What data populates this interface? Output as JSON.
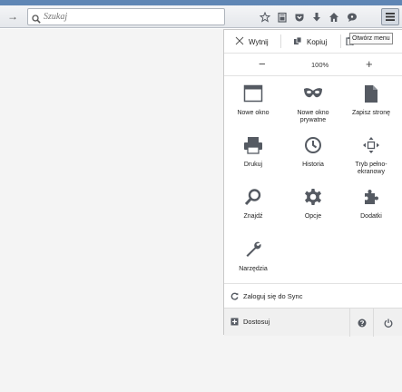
{
  "toolbar": {
    "forward_glyph": "→",
    "search_placeholder": "Szukaj",
    "icons": [
      "forward-icon",
      "search-icon",
      "star-icon",
      "reading-list-icon",
      "pocket-icon",
      "download-icon",
      "home-icon",
      "chat-icon",
      "hamburger-menu-icon"
    ]
  },
  "tooltip": "Otwórz menu",
  "edit": {
    "cut": "Wytnij",
    "copy": "Kopiuj"
  },
  "zoom": {
    "minus": "−",
    "value": "100%",
    "plus": "+"
  },
  "items": [
    {
      "label": "Nowe okno",
      "icon": "new-window-icon"
    },
    {
      "label": "Nowe okno prywatne",
      "icon": "private-mask-icon"
    },
    {
      "label": "Zapisz stronę",
      "icon": "save-page-icon"
    },
    {
      "label": "Drukuj",
      "icon": "print-icon"
    },
    {
      "label": "Historia",
      "icon": "history-clock-icon"
    },
    {
      "label": "Tryb pełno-ekranowy",
      "icon": "fullscreen-icon"
    },
    {
      "label": "Znajdź",
      "icon": "find-icon"
    },
    {
      "label": "Opcje",
      "icon": "options-gear-icon"
    },
    {
      "label": "Dodatki",
      "icon": "addons-puzzle-icon"
    },
    {
      "label": "Narzędzia",
      "icon": "tools-wrench-icon"
    }
  ],
  "sync": "Zaloguj się do Sync",
  "footer": {
    "customize": "Dostosuj"
  },
  "colors": {
    "icon": "#555a62",
    "accent": "#5f86b5"
  }
}
